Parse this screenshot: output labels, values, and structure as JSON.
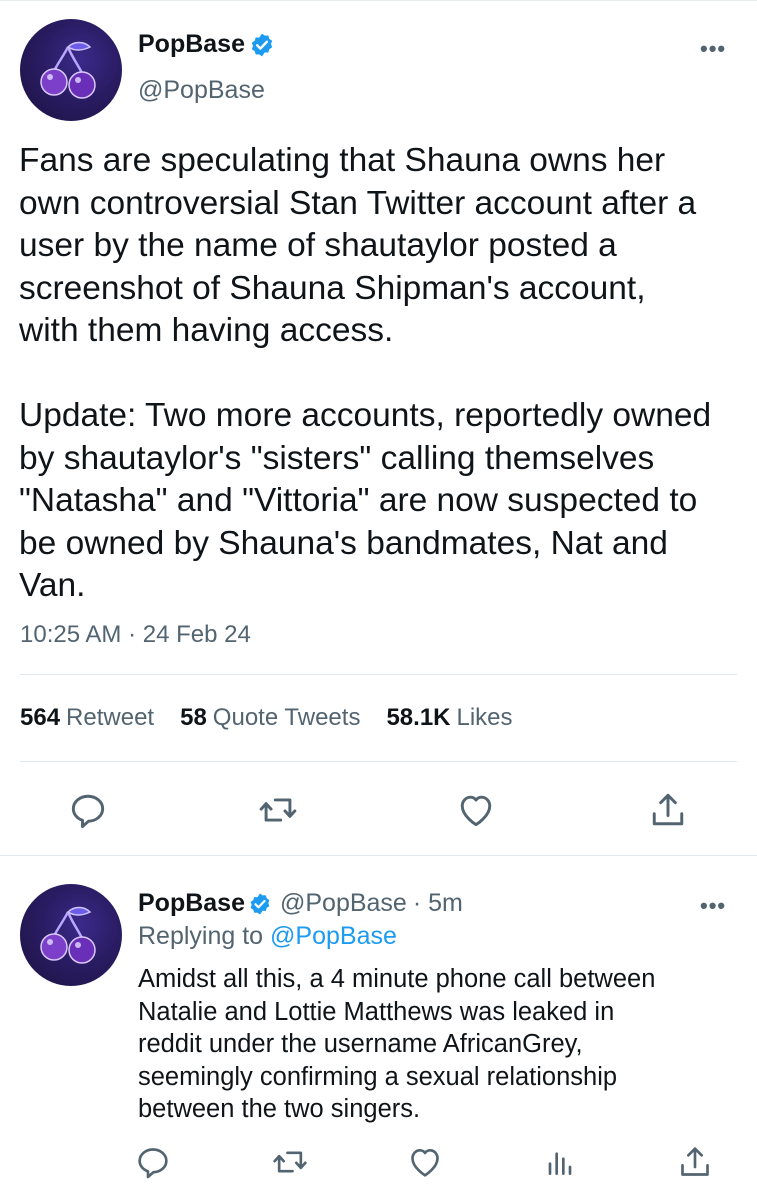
{
  "main_tweet": {
    "display_name": "PopBase",
    "handle": "@PopBase",
    "more": "•••",
    "text_lines": [
      "Fans are speculating that Shauna owns her",
      "own controversial Stan Twitter account after a",
      "user by the name of shautaylor posted a",
      "screenshot of Shauna Shipman's account,",
      "with them having access.",
      "",
      "Update: Two more accounts, reportedly owned",
      "by shautaylor's \"sisters\" calling themselves",
      "\"Natasha\" and \"Vittoria\" are now suspected to",
      "be owned by Shauna's bandmates, Nat and",
      "Van."
    ],
    "timestamp": "10:25 AM · 24 Feb 24",
    "stats": {
      "retweets_count": "564",
      "retweets_label": "Retweet",
      "quotes_count": "58",
      "quotes_label": "Quote Tweets",
      "likes_count": "58.1K",
      "likes_label": "Likes"
    },
    "actions": [
      "reply-icon",
      "retweet-icon",
      "like-icon",
      "share-icon"
    ]
  },
  "reply_tweet": {
    "display_name": "PopBase",
    "handle": "@PopBase",
    "time": "· 5m",
    "more": "•••",
    "replying_prefix": "Replying to",
    "replying_handle": "@PopBase",
    "text_lines": [
      "Amidst all this, a 4 minute phone call between",
      "Natalie and Lottie Matthews was leaked in",
      "reddit under the username AfricanGrey,",
      "seemingly confirming a sexual relationship",
      "between the two singers."
    ],
    "actions": [
      "reply-icon",
      "retweet-icon",
      "like-icon",
      "analytics-icon",
      "share-icon"
    ]
  },
  "colors": {
    "text": "#0f1419",
    "secondary": "#536471",
    "link": "#1d9bf0",
    "verified": "#1d9bf0",
    "divider": "#e1e8ed"
  }
}
